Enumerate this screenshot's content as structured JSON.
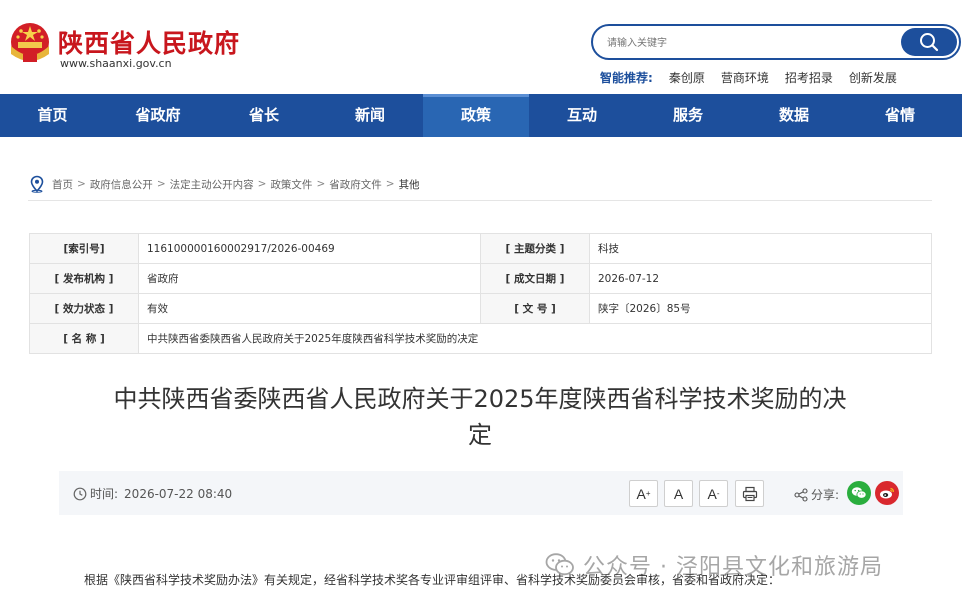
{
  "header": {
    "site_title": "陕西省人民政府",
    "site_url": "www.shaanxi.gov.cn",
    "search_placeholder": "请输入关键字",
    "recommend_label": "智能推荐:",
    "recommend_items": [
      "秦创原",
      "营商环境",
      "招考招录",
      "创新发展"
    ]
  },
  "nav": {
    "items": [
      "首页",
      "省政府",
      "省长",
      "新闻",
      "政策",
      "互动",
      "服务",
      "数据",
      "省情"
    ],
    "active_index": 4
  },
  "breadcrumb": {
    "items": [
      "首页",
      "政府信息公开",
      "法定主动公开内容",
      "政策文件",
      "省政府文件",
      "其他"
    ],
    "separator": ">"
  },
  "info": {
    "index_label": "[索引号]",
    "index_value": "116100000160002917/2026-00469",
    "topic_label": "[ 主题分类 ]",
    "topic_value": "科技",
    "issuer_label": "[ 发布机构 ]",
    "issuer_value": "省政府",
    "date_label": "[ 成文日期 ]",
    "date_value": "2026-07-12",
    "status_label": "[ 效力状态 ]",
    "status_value": "有效",
    "docno_label": "[ 文 号 ]",
    "docno_value": "陕字〔2026〕85号",
    "name_label": "[ 名 称 ]",
    "name_value": "中共陕西省委陕西省人民政府关于2025年度陕西省科学技术奖励的决定"
  },
  "doc": {
    "title_line1": "中共陕西省委陕西省人民政府关于2025年度陕西省科学技术奖励的决",
    "title_line2": "定",
    "time_label": "时间:",
    "time_value": "2026-07-22 08:40",
    "font_increase": "A",
    "font_normal": "A",
    "font_decrease": "A",
    "share_label": "分享:",
    "body_first_line": "根据《陕西省科学技术奖励办法》有关规定，经省科学技术奖各专业评审组评审、省科学技术奖励委员会审核，省委和省政府决定："
  },
  "watermark": {
    "text": "公众号 · 泾阳县文化和旅游局"
  },
  "colors": {
    "brand_red": "#c8161d",
    "nav_blue": "#1d4f9c",
    "wechat_green": "#2aae3e",
    "weibo_red": "#d9282e"
  }
}
